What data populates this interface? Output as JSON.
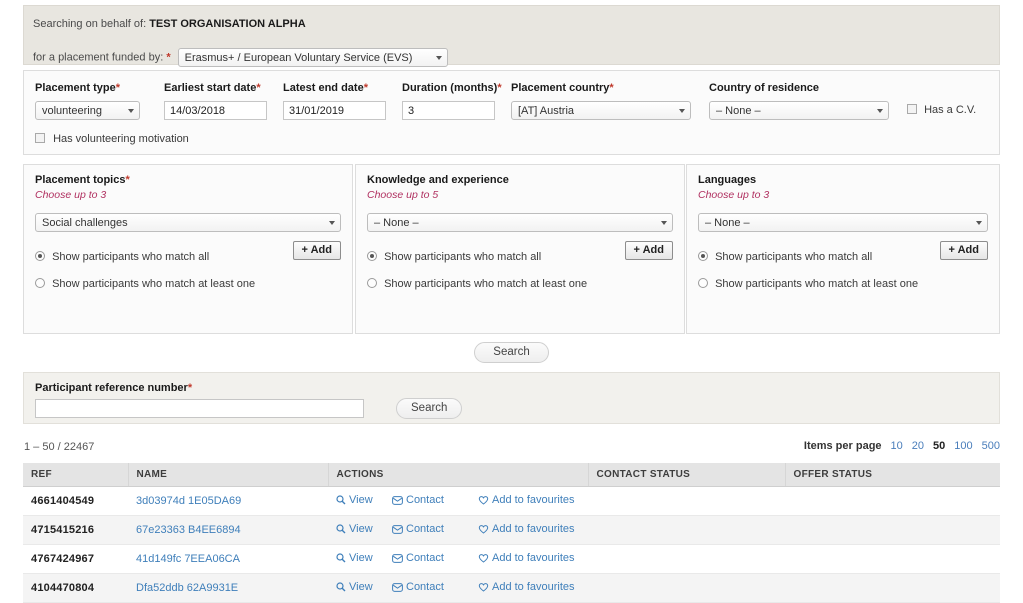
{
  "banner": {
    "searching_prefix": "Searching on behalf of:",
    "organisation": "TEST ORGANISATION ALPHA",
    "funded_prefix": "for a placement funded by:",
    "funded_required": "*",
    "funded_value": "Erasmus+ / European Voluntary Service (EVS)"
  },
  "criteria": {
    "placement_type": {
      "label": "Placement type",
      "required": "*",
      "value": "volunteering"
    },
    "earliest_start": {
      "label": "Earliest start date",
      "required": "*",
      "value": "14/03/2018"
    },
    "latest_end": {
      "label": "Latest end date",
      "required": "*",
      "value": "31/01/2019"
    },
    "duration": {
      "label": "Duration (months)",
      "required": "*",
      "value": "3"
    },
    "placement_country": {
      "label": "Placement country",
      "required": "*",
      "value": "[AT] Austria"
    },
    "country_residence": {
      "label": "Country of residence",
      "value": "– None –"
    },
    "has_cv": {
      "label": "Has a C.V.",
      "checked": false
    },
    "has_motivation": {
      "label": "Has volunteering motivation",
      "checked": false
    }
  },
  "panels": [
    {
      "title": "Placement topics",
      "required": "*",
      "hint": "Choose up to 3",
      "value": "Social challenges",
      "add_label": "+ Add",
      "match_all": "Show participants who match all",
      "match_one": "Show participants who match at least one",
      "selected": "all"
    },
    {
      "title": "Knowledge and experience",
      "required": "",
      "hint": "Choose up to 5",
      "value": "– None –",
      "add_label": "+ Add",
      "match_all": "Show participants who match all",
      "match_one": "Show participants who match at least one",
      "selected": "all"
    },
    {
      "title": "Languages",
      "required": "",
      "hint": "Choose up to 3",
      "value": "– None –",
      "add_label": "+ Add",
      "match_all": "Show participants who match all",
      "match_one": "Show participants who match at least one",
      "selected": "all"
    }
  ],
  "main_search_button": "Search",
  "ref_search": {
    "label": "Participant reference number",
    "required": "*",
    "value": "",
    "placeholder": "",
    "button": "Search"
  },
  "results": {
    "count_text": "1 – 50 / 22467",
    "items_per_page_label": "Items per page",
    "page_sizes": [
      "10",
      "20",
      "50",
      "100",
      "500"
    ],
    "page_size_selected": "50",
    "columns": [
      "REF",
      "NAME",
      "ACTIONS",
      "CONTACT STATUS",
      "OFFER STATUS"
    ],
    "action_labels": {
      "view": "View",
      "contact": "Contact",
      "favourite": "Add to favourites"
    },
    "rows": [
      {
        "ref": "4661404549",
        "name": "3d03974d 1E05DA69",
        "contact_status": "",
        "offer_status": ""
      },
      {
        "ref": "4715415216",
        "name": "67e23363 B4EE6894",
        "contact_status": "",
        "offer_status": ""
      },
      {
        "ref": "4767424967",
        "name": "41d149fc 7EEA06CA",
        "contact_status": "",
        "offer_status": ""
      },
      {
        "ref": "4104470804",
        "name": "Dfa52ddb 62A9931E",
        "contact_status": "",
        "offer_status": ""
      }
    ]
  },
  "colors": {
    "banner_bg": "#e8e6e0",
    "link": "#3f7fba",
    "required": "#c0392b",
    "hint": "#b03060",
    "header_bg": "#e4e4e4"
  }
}
